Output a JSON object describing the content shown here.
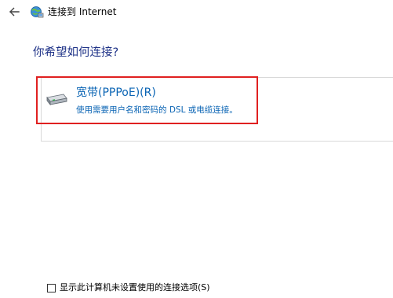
{
  "header": {
    "back_icon": "back-arrow-icon",
    "window_icon": "network-globe-icon",
    "title": "连接到 Internet"
  },
  "main": {
    "heading": "你希望如何连接?",
    "options": [
      {
        "icon": "broadband-modem-icon",
        "title": "宽带(PPPoE)(R)",
        "description": "使用需要用户名和密码的 DSL 或电缆连接。"
      }
    ]
  },
  "footer": {
    "checkbox_label": "显示此计算机未设置使用的连接选项(S)",
    "checked": false
  },
  "colors": {
    "heading": "#1e3287",
    "link": "#0a64b4",
    "highlight_border": "#e02020"
  }
}
